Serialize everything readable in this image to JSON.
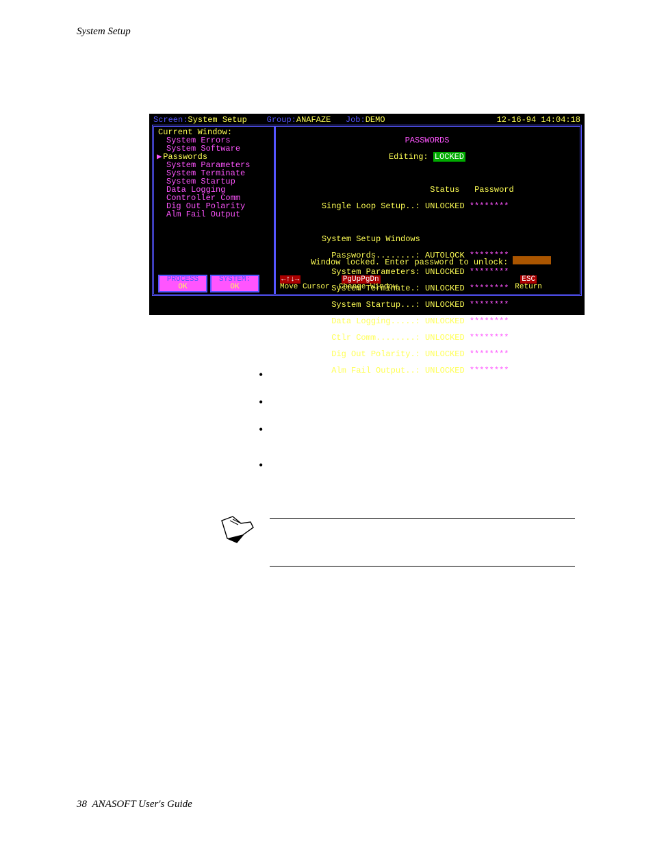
{
  "header": "System Setup",
  "footer_page": "38",
  "footer_title": "ANASOFT User's Guide",
  "topbar": {
    "screen_label": "Screen:",
    "screen_value": "System Setup",
    "group_label": "Group:",
    "group_value": "ANAFAZE",
    "job_label": "Job:",
    "job_value": "DEMO",
    "datetime": "12-16-94 14:04:18"
  },
  "menu": {
    "current_window": "Current Window:",
    "items": [
      "System Errors",
      "System Software",
      "Passwords",
      "System Parameters",
      "System Terminate",
      "System Startup",
      "Data Logging",
      "Controller Comm",
      "Dig Out Polarity",
      "Alm Fail Output"
    ],
    "selected_index": 2
  },
  "passwords": {
    "title": "PASSWORDS",
    "editing_label": "Editing:",
    "editing_value": "LOCKED",
    "col_status": "Status",
    "col_password": "Password",
    "single_loop": {
      "label": "Single Loop Setup..:",
      "status": "UNLOCKED",
      "pw": "********"
    },
    "section": "System Setup Windows",
    "rows": [
      {
        "label": "Passwords........:",
        "status": "AUTOLOCK",
        "pw": "********"
      },
      {
        "label": "System Parameters:",
        "status": "UNLOCKED",
        "pw": "********"
      },
      {
        "label": "System Terminate.:",
        "status": "UNLOCKED",
        "pw": "********"
      },
      {
        "label": "System Startup...:",
        "status": "UNLOCKED",
        "pw": "********"
      },
      {
        "label": "Data Logging.....:",
        "status": "UNLOCKED",
        "pw": "********"
      },
      {
        "label": "Ctlr Comm........:",
        "status": "UNLOCKED",
        "pw": "********"
      },
      {
        "label": "Dig Out Polarity.:",
        "status": "UNLOCKED",
        "pw": "********"
      },
      {
        "label": "Alm Fail Output..:",
        "status": "UNLOCKED",
        "pw": "********"
      }
    ],
    "prompt": "Window locked. Enter password to unlock:"
  },
  "status": {
    "process_label": "PROCESS",
    "process_value": "OK",
    "system_label": "SYSTEM:",
    "system_value": "OK"
  },
  "hints": {
    "arrows_key": "←↑↓→",
    "arrows_label": "Move Cursor",
    "page_key": "PgUpPgDn",
    "page_label": "Change Window",
    "esc_key": "ESC",
    "esc_label": "Return"
  }
}
